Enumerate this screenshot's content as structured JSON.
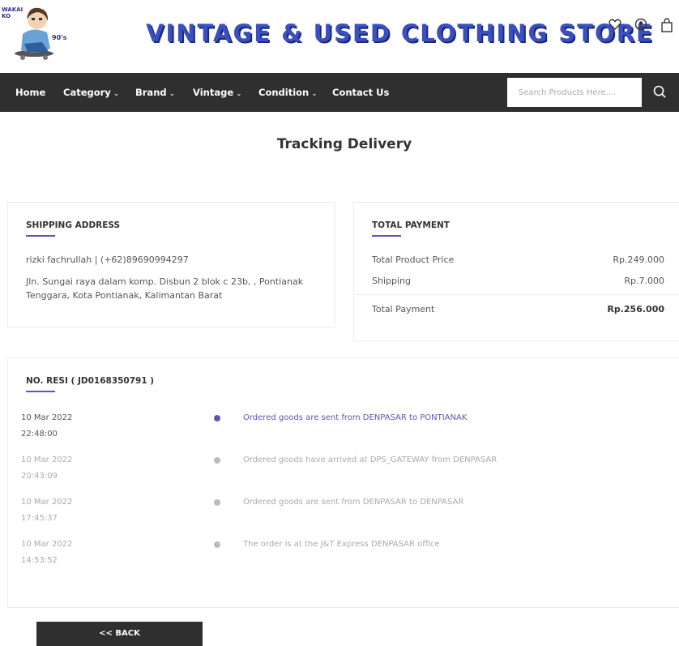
{
  "header": {
    "logo": {
      "text_top": "WAKAI KO",
      "text_side": "90's"
    },
    "title": "VINTAGE & USED CLOTHING STORE",
    "icons": [
      "heart-icon",
      "user-icon",
      "bag-icon"
    ]
  },
  "nav": {
    "items": [
      {
        "label": "Home",
        "has_dropdown": false
      },
      {
        "label": "Category",
        "has_dropdown": true
      },
      {
        "label": "Brand",
        "has_dropdown": true
      },
      {
        "label": "Vintage",
        "has_dropdown": true
      },
      {
        "label": "Condition",
        "has_dropdown": true
      },
      {
        "label": "Contact Us",
        "has_dropdown": false
      }
    ],
    "search": {
      "placeholder": "Search Products Here....",
      "value": ""
    }
  },
  "page": {
    "title": "Tracking Delivery"
  },
  "shipping": {
    "heading": "SHIPPING ADDRESS",
    "recipient": "rizki fachrullah | (+62)89690994297",
    "address": "Jln. Sungai raya dalam komp. Disbun 2 blok c 23b, , Pontianak Tenggara, Kota Pontianak, Kalimantan Barat"
  },
  "payment": {
    "heading": "TOTAL PAYMENT",
    "rows": [
      {
        "label": "Total Product Price",
        "value": "Rp.249.000"
      },
      {
        "label": "Shipping",
        "value": "Rp.7.000"
      }
    ],
    "total": {
      "label": "Total Payment",
      "value": "Rp.256.000"
    }
  },
  "tracking": {
    "heading": "NO. RESI ( JD0168350791 )",
    "events": [
      {
        "date": "10 Mar 2022",
        "time": "22:48:00",
        "desc": "Ordered goods are sent from DENPASAR to PONTIANAK",
        "active": true
      },
      {
        "date": "10 Mar 2022",
        "time": "20:43:09",
        "desc": "Ordered goods have arrived at DPS_GATEWAY from DENPASAR",
        "active": false
      },
      {
        "date": "10 Mar 2022",
        "time": "17:45:37",
        "desc": "Ordered goods are sent from DENPASAR to DENPASAR",
        "active": false
      },
      {
        "date": "10 Mar 2022",
        "time": "14:53:52",
        "desc": "The order is at the J&T Express DENPASAR office",
        "active": false
      }
    ]
  },
  "back_button": {
    "label": "<< BACK"
  },
  "colors": {
    "accent": "#5e55b5",
    "nav_bg": "#2f2f2f",
    "title_blue": "#3a4fc0"
  }
}
